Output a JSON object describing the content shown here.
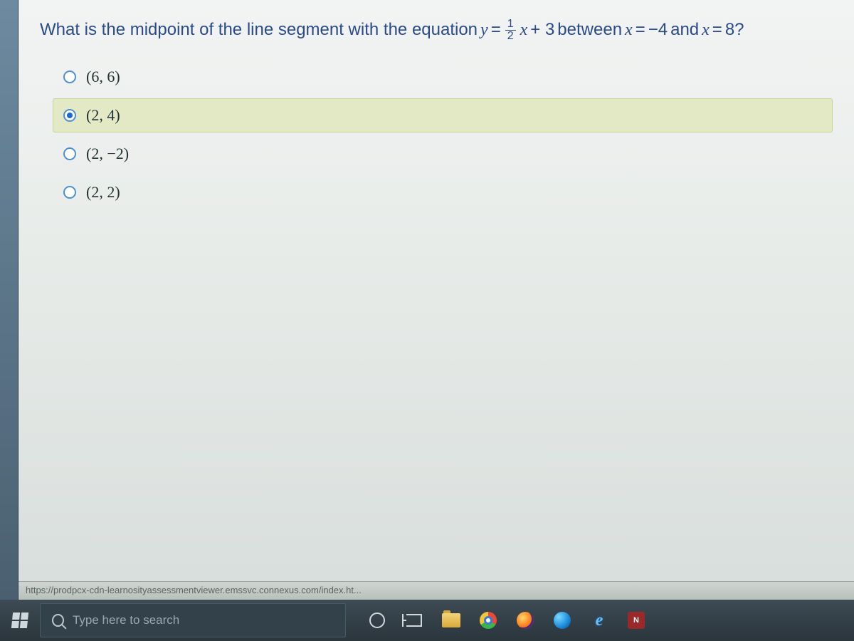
{
  "question": {
    "prefix": "What is the midpoint of the line segment with the equation ",
    "eq_lhs_var": "y",
    "eq_eq": " = ",
    "frac_num": "1",
    "frac_den": "2",
    "eq_var": "x",
    "eq_tail": " + 3",
    "between": " between ",
    "x1_var": "x",
    "x1_eq": " = ",
    "x1_val": "−4",
    "and": " and ",
    "x2_var": "x",
    "x2_eq": " = ",
    "x2_val": "8?"
  },
  "options": {
    "a": "(6, 6)",
    "b": "(2, 4)",
    "c": "(2, −2)",
    "d": "(2, 2)"
  },
  "selected_index": 1,
  "status_url": "https://prodpcx-cdn-learnosityassessmentviewer.emssvc.connexus.com/index.ht...",
  "taskbar": {
    "search_placeholder": "Type here to search",
    "np_label": "N"
  }
}
